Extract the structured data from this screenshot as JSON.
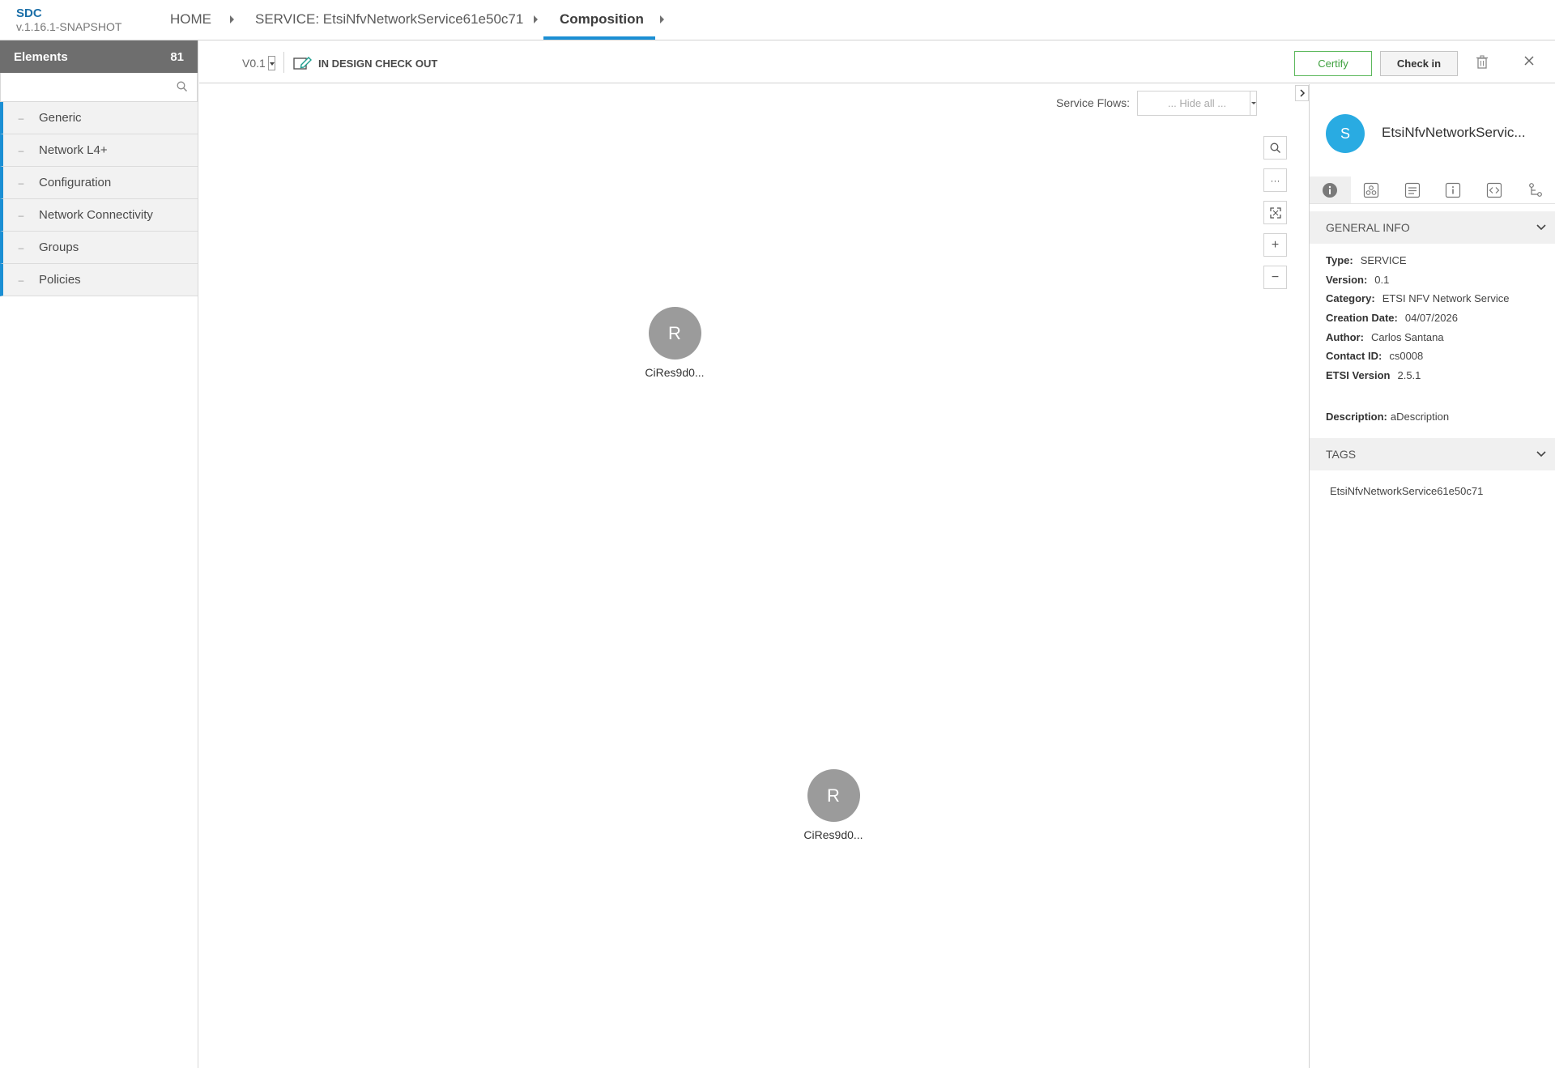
{
  "header": {
    "brand_name": "SDC",
    "brand_version": "v.1.16.1-SNAPSHOT",
    "breadcrumbs": [
      {
        "label": "HOME"
      },
      {
        "label": "SERVICE: EtsiNfvNetworkService61e50c71"
      },
      {
        "label": "Composition"
      }
    ]
  },
  "palette": {
    "title": "Elements",
    "count": "81",
    "search_placeholder": "",
    "groups": [
      {
        "label": "Generic"
      },
      {
        "label": "Network L4+"
      },
      {
        "label": "Configuration"
      },
      {
        "label": "Network Connectivity"
      },
      {
        "label": "Groups"
      },
      {
        "label": "Policies"
      }
    ]
  },
  "toolbar": {
    "version": "V0.1",
    "status": "IN DESIGN CHECK OUT",
    "certify_label": "Certify",
    "checkin_label": "Check in"
  },
  "canvas": {
    "service_flows_label": "Service Flows:",
    "service_flows_value": "... Hide all ...",
    "nodes": [
      {
        "letter": "R",
        "label": "CiRes9d0..."
      },
      {
        "letter": "R",
        "label": "CiRes9d0..."
      }
    ]
  },
  "right_panel": {
    "avatar_letter": "S",
    "title": "EtsiNfvNetworkServic...",
    "general_info_title": "GENERAL INFO",
    "info": [
      {
        "key": "Type:",
        "value": "SERVICE"
      },
      {
        "key": "Version:",
        "value": "0.1"
      },
      {
        "key": "Category:",
        "value": "ETSI NFV Network Service"
      },
      {
        "key": "Creation Date:",
        "value": "04/07/2026"
      },
      {
        "key": "Author:",
        "value": "Carlos Santana"
      },
      {
        "key": "Contact ID:",
        "value": "cs0008"
      },
      {
        "key": "ETSI Version",
        "value": "2.5.1"
      }
    ],
    "description_key": "Description:",
    "description_value": "aDescription",
    "tags_title": "TAGS",
    "tags": [
      "EtsiNfvNetworkService61e50c71"
    ]
  },
  "colors": {
    "accent": "#1b8fd4",
    "certify_green": "#5cb85c",
    "avatar_blue": "#29abe2",
    "node_gray": "#9b9b9b"
  }
}
